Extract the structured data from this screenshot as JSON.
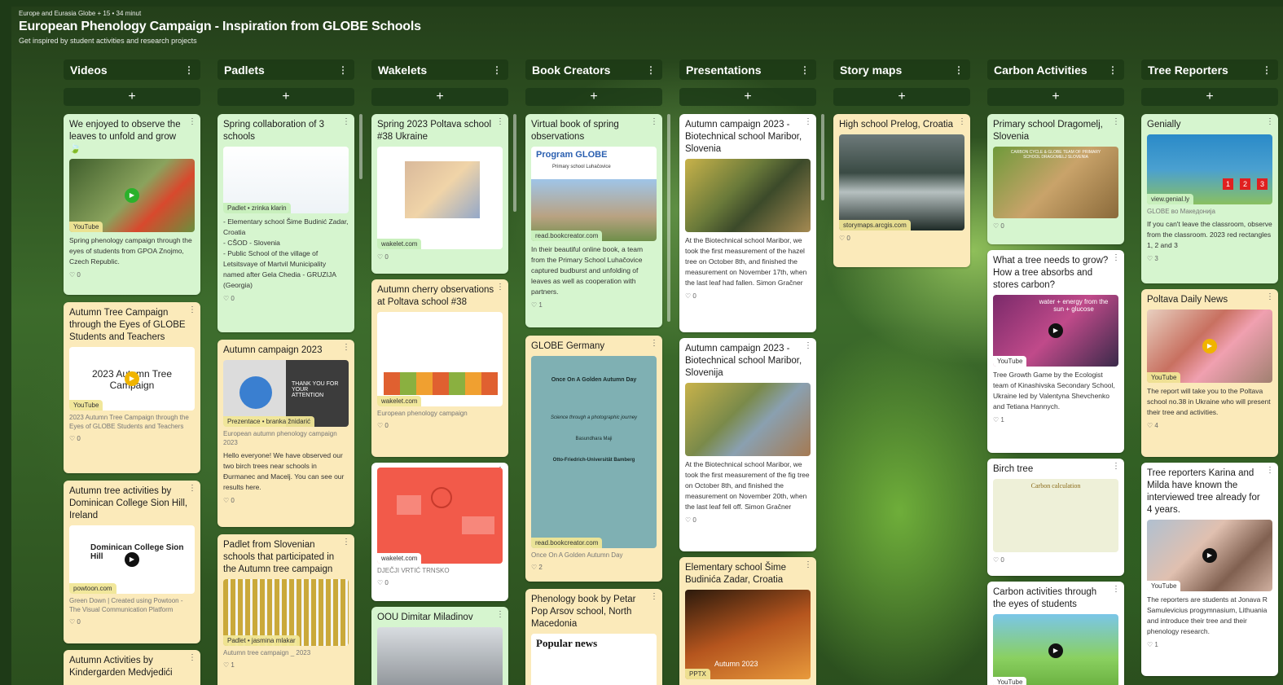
{
  "header": {
    "meta": "Europe and Eurasia Globe + 15 • 34 minut",
    "title": "European Phenology Campaign - Inspiration from GLOBE Schools",
    "description": "Get inspired by student activities and research projects"
  },
  "add_label": "+",
  "columns": [
    {
      "title": "Videos",
      "cards": [
        {
          "title": "We enjoyed to observe the leaves to unfold and grow 🍃",
          "source": "YouTube",
          "body": "Spring phenology campaign through the eyes of students from GPOA Znojmo, Czech Republic.",
          "likes": "0"
        },
        {
          "title": "Autumn Tree Campaign through the Eyes of GLOBE Students and Teachers",
          "thumb_text": "2023 Autumn Tree Campaign",
          "source": "YouTube",
          "small": "2023 Autumn Tree Campaign through the Eyes of GLOBE Students and Teachers",
          "likes": "0"
        },
        {
          "title": "Autumn tree activities by Dominican College Sion Hill, Ireland",
          "thumb_text": "Dominican College Sion Hill",
          "source": "powtoon.com",
          "small": "Green Down | Created using Powtoon - The Visual Communication Platform",
          "likes": "0"
        },
        {
          "title": "Autumn Activities by Kindergarden Medvjedići"
        }
      ]
    },
    {
      "title": "Padlets",
      "cards": [
        {
          "title": "Spring collaboration of 3 schools",
          "source": "Padlet • zrinka klarin",
          "body": "- Elementary school Šime Budinić Zadar, Croatia\n- CŠOD - Slovenia\n- Public School of the village of Letsitsvaye of Martvil Municipality named after Gela Chedia - GRUZIJA (Georgia)",
          "likes": "0"
        },
        {
          "title": "Autumn campaign 2023",
          "thumb_text": "THANK YOU FOR YOUR ATTENTION",
          "source": "Prezentace • branka žnidarić",
          "small": "European autumn phenology campaign 2023",
          "body": "Hello everyone! We have observed our two birch trees near schools in Đurmanec and Macelj. You can see our results here.",
          "likes": "0"
        },
        {
          "title": "Padlet from Slovenian schools that participated in the Autumn tree campaign",
          "source": "Padlet • jasmina mlakar",
          "small": "Autumn tree campaign _ 2023",
          "likes": "1"
        }
      ]
    },
    {
      "title": "Wakelets",
      "cards": [
        {
          "title": "Spring 2023 Poltava school #38 Ukraine",
          "source": "wakelet.com",
          "likes": "0"
        },
        {
          "title": "Autumn cherry observations at Poltava school #38",
          "source": "wakelet.com",
          "small": "European phenology campaign",
          "likes": "0"
        },
        {
          "title": "",
          "source": "wakelet.com",
          "small": "DJEČJI VRTIĆ TRNSKO",
          "likes": "0"
        },
        {
          "title": "OOU Dimitar Miladinov"
        }
      ]
    },
    {
      "title": "Book Creators",
      "cards": [
        {
          "title": "Virtual book of spring observations",
          "thumb_text": "Program GLOBE",
          "thumb_sub": "Primary school Luhačovice",
          "source": "read.bookcreator.com",
          "body": "In their beautiful online book, a team from the Primary School Luhačovice captured budburst and unfolding of leaves as well as cooperation with partners.",
          "likes": "1"
        },
        {
          "title": "GLOBE Germany",
          "thumb_text": "Once On A Golden Autumn Day",
          "thumb_sub": "Science through a photographic journey",
          "thumb_author": "Basundhara Maji",
          "thumb_uni": "Otto-Friedrich-Universität Bamberg",
          "source": "read.bookcreator.com",
          "small": "Once On A Golden Autumn Day",
          "likes": "2"
        },
        {
          "title": "Phenology book by Petar Pop Arsov school, North Macedonia",
          "thumb_text": "Popular news"
        }
      ]
    },
    {
      "title": "Presentations",
      "cards": [
        {
          "title": "Autumn campaign 2023 - Biotechnical school Maribor, Slovenia",
          "body": "At the Biotechnical school Maribor, we took the first measurement of the hazel tree on October 8th, and finished the measurement on November 17th, when the last leaf had fallen. Simon Gračner",
          "likes": "0"
        },
        {
          "title": "Autumn campaign 2023 - Biotechnical school Maribor, Slovenija",
          "body": "At the Biotechnical school Maribor, we took the first measurement of the fig tree on October 8th, and finished the measurement on November 20th, when the last leaf fell off. Simon Gračner",
          "likes": "0"
        },
        {
          "title": "Elementary school Šime Budinića Zadar, Croatia",
          "thumb_text": "Autumn 2023",
          "source": "PPTX"
        }
      ]
    },
    {
      "title": "Story maps",
      "cards": [
        {
          "title": "High school Prelog, Croatia",
          "source": "storymaps.arcgis.com",
          "likes": "0"
        }
      ]
    },
    {
      "title": "Carbon Activities",
      "cards": [
        {
          "title": "Primary school Dragomelj, Slovenia",
          "thumb_text": "CARBON CYCLE & GLOBE TEAM OF PRIMARY SCHOOL DRAGOMELJ SLOVENIA",
          "likes": "0"
        },
        {
          "title": "What a tree needs to grow? How a tree absorbs and stores carbon?",
          "thumb_text": "water + energy from the sun + glucose",
          "source": "YouTube",
          "body": "Tree Growth Game by the Ecologist team of Kinashivska Secondary School, Ukraine led by Valentyna Shevchenko and Tetiana Hannych.",
          "likes": "1"
        },
        {
          "title": "Birch tree",
          "thumb_text": "Carbon calculation",
          "likes": "0"
        },
        {
          "title": "Carbon activities through the eyes of students",
          "source": "YouTube"
        }
      ]
    },
    {
      "title": "Tree Reporters",
      "cards": [
        {
          "title": "Genially",
          "source": "view.genial.ly",
          "thumb_nums": [
            "1",
            "2",
            "3"
          ],
          "small": "GLOBE во Македонија",
          "body": "If you can't leave the classroom, observe from the classroom. 2023 red rectangles 1, 2 and 3",
          "likes": "3"
        },
        {
          "title": "Poltava Daily News",
          "source": "YouTube",
          "body": "The report will take you to the Poltava school no.38 in Ukraine who will present their tree and activities.",
          "likes": "4"
        },
        {
          "title": "Tree reporters Karina and Milda have known the interviewed tree already for 4 years.",
          "source": "YouTube",
          "body": "The reporters are students at Jonava R Samulevicius progymnasium, Lithuania and introduce their tree and their phenology research.",
          "likes": "1"
        }
      ]
    }
  ]
}
